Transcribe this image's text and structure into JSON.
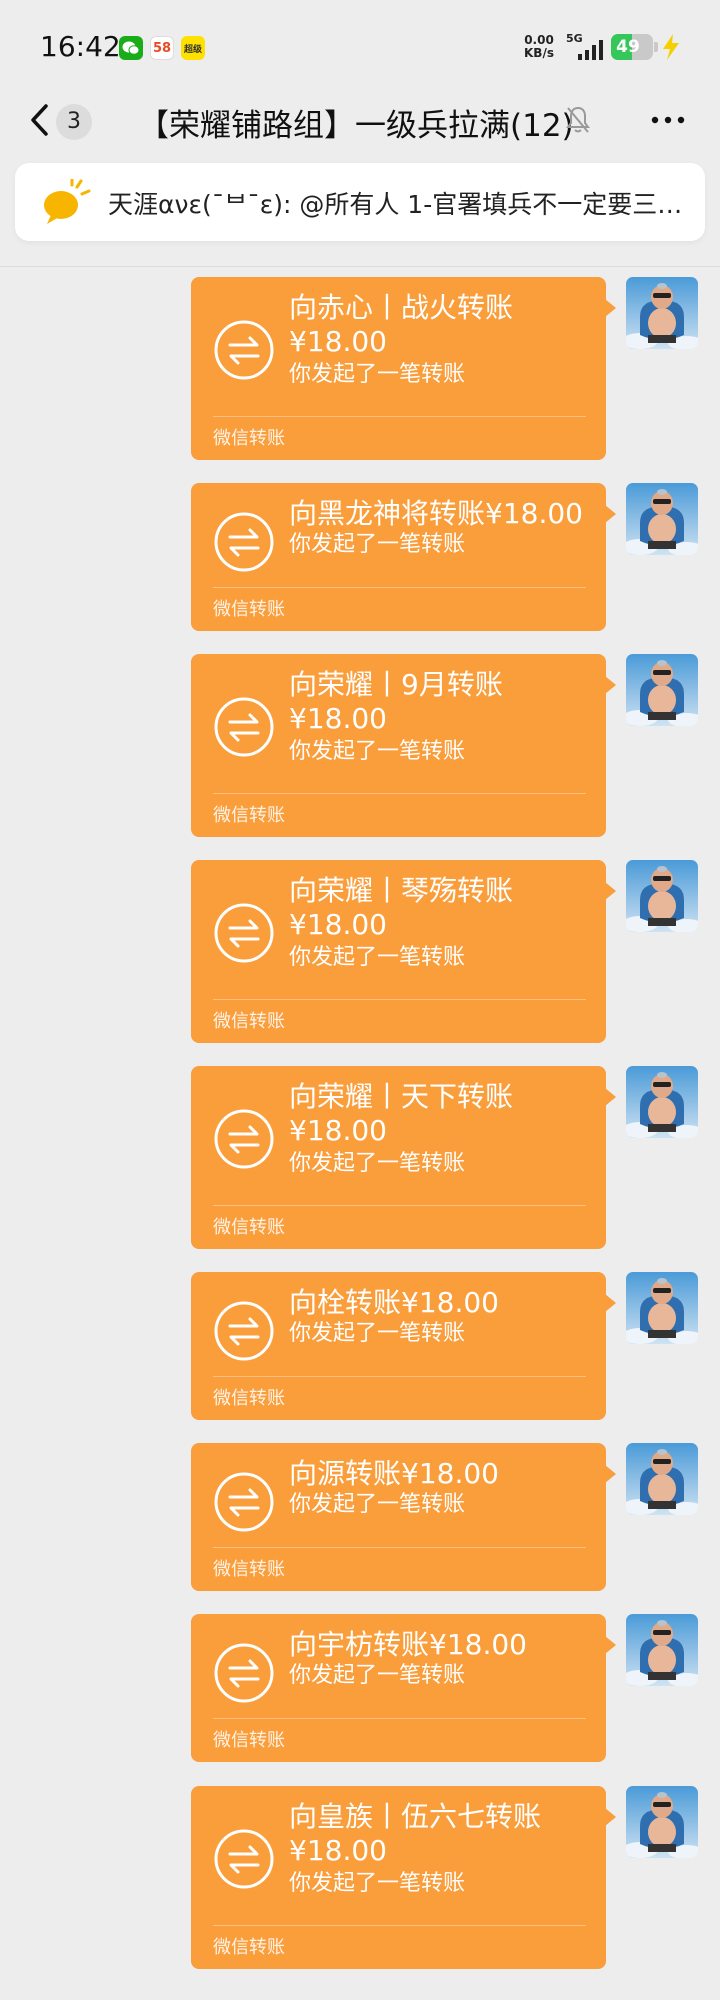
{
  "status_bar": {
    "time": "16:42",
    "apps": [
      "wechat-icon",
      "58-app-icon",
      "alipay-icon"
    ],
    "app_58_label": "58",
    "app_ali_label": "超级",
    "net_speed_value": "0.00",
    "net_speed_unit": "KB/s",
    "network_type": "5G",
    "battery_level": "49",
    "battery_percent": 49,
    "accent_colors": {
      "battery": "#35c759",
      "charging": "#f5d000"
    }
  },
  "nav": {
    "back_icon": "chevron-left-icon",
    "unread_count": "3",
    "title": "【荣耀铺路组】一级兵拉满(12)",
    "mute_icon": "bell-off-icon",
    "more_icon": "more-horizontal-icon"
  },
  "pinned_notice": {
    "icon": "speech-bubble-icon",
    "text": "天涯ανε(ˉᄇˉε): @所有人  1-官署填兵不一定要三…"
  },
  "theme": {
    "bubble_color": "#fa9d3b",
    "background": "#ededed"
  },
  "messages": [
    {
      "title": "向赤心丨战火转账",
      "amount": "¥18.00",
      "subtitle": "你发起了一笔转账",
      "footer": "微信转账"
    },
    {
      "title": "向黑龙神将转账¥18.00",
      "amount": "",
      "subtitle": "你发起了一笔转账",
      "footer": "微信转账"
    },
    {
      "title": "向荣耀丨9月转账",
      "amount": "¥18.00",
      "subtitle": "你发起了一笔转账",
      "footer": "微信转账"
    },
    {
      "title": "向荣耀丨琴殇转账",
      "amount": "¥18.00",
      "subtitle": "你发起了一笔转账",
      "footer": "微信转账"
    },
    {
      "title": "向荣耀丨天下转账",
      "amount": "¥18.00",
      "subtitle": "你发起了一笔转账",
      "footer": "微信转账"
    },
    {
      "title": "向栓转账¥18.00",
      "amount": "",
      "subtitle": "你发起了一笔转账",
      "footer": "微信转账"
    },
    {
      "title": "向源转账¥18.00",
      "amount": "",
      "subtitle": "你发起了一笔转账",
      "footer": "微信转账"
    },
    {
      "title": "向宇枋转账¥18.00",
      "amount": "",
      "subtitle": "你发起了一笔转账",
      "footer": "微信转账"
    },
    {
      "title": "向皇族丨伍六七转账",
      "amount": "¥18.00",
      "subtitle": "你发起了一笔转账",
      "footer": "微信转账"
    }
  ]
}
